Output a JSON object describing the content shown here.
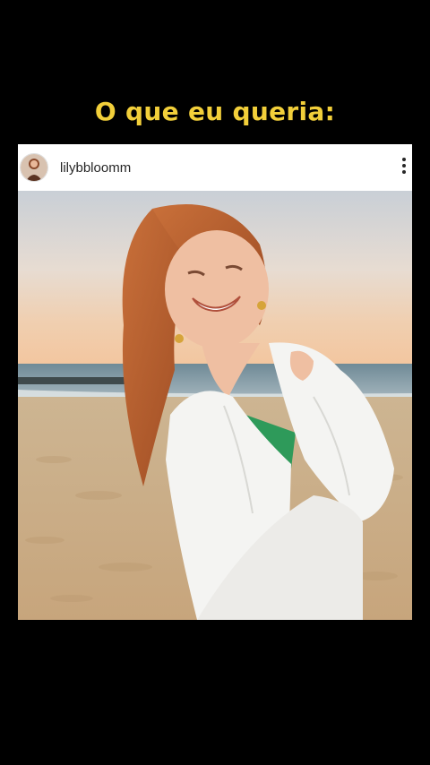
{
  "caption": "O que eu queria:",
  "post": {
    "username": "lilybbloomm",
    "avatar_icon": "profile-avatar-icon",
    "more_icon": "more-options-icon"
  },
  "colors": {
    "background": "#000000",
    "caption": "#f2cf3a",
    "post_background": "#ffffff",
    "username": "#262626"
  }
}
